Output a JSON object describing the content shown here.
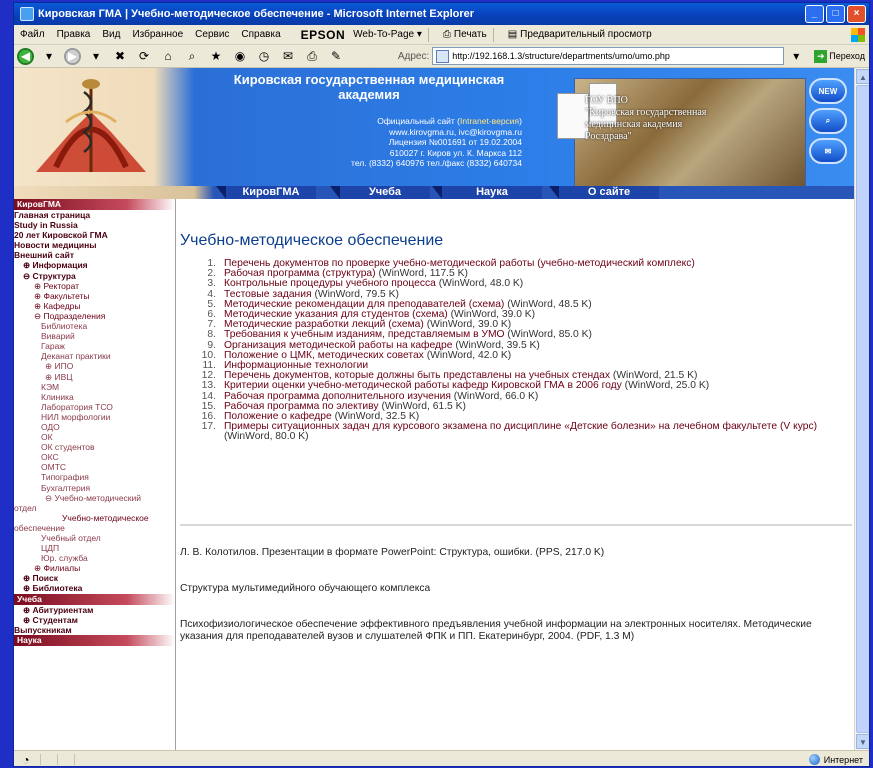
{
  "window": {
    "title": "Кировская ГМА | Учебно-методическое обеспечение - Microsoft Internet Explorer",
    "controls": [
      "_",
      "□",
      "×"
    ]
  },
  "menubar": {
    "items": [
      "Файл",
      "Правка",
      "Вид",
      "Избранное",
      "Сервис",
      "Справка"
    ],
    "epson": "EPSON",
    "web_to_page": "Web-To-Page ▾",
    "print": "Печать",
    "preview": "Предварительный просмотр"
  },
  "toolbar": {
    "address_label": "Адрес:",
    "address_value": "http://192.168.1.3/structure/departments/umo/umo.php",
    "go_label": "Переход"
  },
  "banner": {
    "title_line1": "Кировская государственная медицинская",
    "title_line2": "академия",
    "info_line1_prefix": "Официальный сайт (",
    "info_line1_kv": "Intranet-версия",
    "info_line1_suffix": ")",
    "info_line2": "www.kirovgma.ru, ivc@kirovgma.ru",
    "info_line3": "Лицензия №001691 от 19.02.2004",
    "info_line4": "610027 г. Киров ул. К. Маркса 112",
    "info_line5": "тел. (8332) 640976 тел./факс (8332) 640734",
    "plaque_line1": "ГОУ ВПО",
    "plaque_line2": "\"Кировская государственная",
    "plaque_line3": "медицинская академия",
    "plaque_line4": "Росздрава\"",
    "side_buttons": [
      "NEW",
      "⌕",
      "✉"
    ]
  },
  "nav": {
    "tabs": [
      "КировГМА",
      "Учеба",
      "Наука",
      "О сайте"
    ]
  },
  "sidebar": {
    "section_kirov": "КировГМА",
    "items": [
      {
        "label": "Главная страница",
        "cls": "b"
      },
      {
        "label": "Study in Russia",
        "cls": "b"
      },
      {
        "label": "20 лет Кировской ГМА",
        "cls": "b"
      },
      {
        "label": "Новости медицины",
        "cls": "b"
      },
      {
        "label": "Внешний сайт",
        "cls": "b"
      },
      {
        "label": "⊕ Информация",
        "cls": "b l1"
      },
      {
        "label": "⊖ Структура",
        "cls": "b l1"
      },
      {
        "label": "⊕ Ректорат",
        "cls": "l2"
      },
      {
        "label": "⊕ Факультеты",
        "cls": "l2"
      },
      {
        "label": "⊕ Кафедры",
        "cls": "l2"
      },
      {
        "label": "⊖ Подразделения",
        "cls": "l2"
      },
      {
        "label": "Библиотека",
        "cls": "l3"
      },
      {
        "label": "Виварий",
        "cls": "l3"
      },
      {
        "label": "Гараж",
        "cls": "l3"
      },
      {
        "label": "Деканат практики",
        "cls": "l3"
      },
      {
        "label": "⊕ ИПО",
        "cls": "l4"
      },
      {
        "label": "⊕ ИВЦ",
        "cls": "l4"
      },
      {
        "label": "КЭМ",
        "cls": "l3"
      },
      {
        "label": "Клиника",
        "cls": "l3"
      },
      {
        "label": "Лаборатория ТСО",
        "cls": "l3"
      },
      {
        "label": "НИЛ морфологии",
        "cls": "l3"
      },
      {
        "label": "ОДО",
        "cls": "l3"
      },
      {
        "label": "ОК",
        "cls": "l3"
      },
      {
        "label": "ОК студентов",
        "cls": "l3"
      },
      {
        "label": "ОКС",
        "cls": "l3"
      },
      {
        "label": "ОМТС",
        "cls": "l3"
      },
      {
        "label": "Типография",
        "cls": "l3"
      },
      {
        "label": "Бухгалтерия",
        "cls": "l3"
      },
      {
        "label": "⊖ Учебно-методический",
        "cls": "l4"
      },
      {
        "label": "отдел",
        "cls": "l0"
      },
      {
        "label": "Учебно-методическое",
        "cls": "wrap"
      },
      {
        "label": "обеспечение",
        "cls": "l0"
      },
      {
        "label": "Учебный отдел",
        "cls": "l3"
      },
      {
        "label": "ЦДП",
        "cls": "l3"
      },
      {
        "label": "Юр. служба",
        "cls": "l3"
      },
      {
        "label": "⊕ Филиалы",
        "cls": "l2"
      },
      {
        "label": "⊕ Поиск",
        "cls": "b l1"
      },
      {
        "label": "⊕ Библиотека",
        "cls": "b l1"
      }
    ],
    "section_study": "Учеба",
    "study_items": [
      {
        "label": "⊕ Абитуриентам",
        "cls": "b l1"
      },
      {
        "label": "⊕ Студентам",
        "cls": "b l1"
      },
      {
        "label": "Выпускникам",
        "cls": "b"
      }
    ],
    "section_science": "Наука"
  },
  "content": {
    "title": "Учебно-методическое обеспечение",
    "documents": [
      {
        "n": "1.",
        "text": "Перечень документов по проверке учебно-методической работы (учебно-методический комплекс)",
        "meta": ""
      },
      {
        "n": "2.",
        "text": "Рабочая программа (структура)",
        "meta": " (WinWord, 117.5 K)"
      },
      {
        "n": "3.",
        "text": "Контрольные процедуры учебного процесса",
        "meta": " (WinWord, 48.0 K)"
      },
      {
        "n": "4.",
        "text": "Тестовые задания",
        "meta": " (WinWord, 79.5 K)"
      },
      {
        "n": "5.",
        "text": "Методические рекомендации для преподавателей (схема)",
        "meta": " (WinWord, 48.5 K)"
      },
      {
        "n": "6.",
        "text": "Методические указания для студентов (схема)",
        "meta": " (WinWord, 39.0 K)"
      },
      {
        "n": "7.",
        "text": "Методические разработки лекций (схема)",
        "meta": " (WinWord, 39.0 K)"
      },
      {
        "n": "8.",
        "text": "Требования к учебным изданиям, представляемым в УМО",
        "meta": " (WinWord, 85.0 K)"
      },
      {
        "n": "9.",
        "text": "Организация методической работы на кафедре",
        "meta": " (WinWord, 39.5 K)"
      },
      {
        "n": "10.",
        "text": "Положение о ЦМК, методических советах",
        "meta": " (WinWord, 42.0 K)"
      },
      {
        "n": "11.",
        "text": "Информационные технологии",
        "meta": ""
      },
      {
        "n": "12.",
        "text": "Перечень документов, которые должны быть представлены на учебных стендах",
        "meta": " (WinWord, 21.5 K)"
      },
      {
        "n": "13.",
        "text": "Критерии оценки учебно-методической работы кафедр Кировской ГМА в 2006 году",
        "meta": " (WinWord, 25.0 K)"
      },
      {
        "n": "14.",
        "text": "Рабочая программа дополнительного изучения",
        "meta": " (WinWord, 66.0 K)"
      },
      {
        "n": "15.",
        "text": "Рабочая программа по элективу",
        "meta": " (WinWord, 61.5 K)"
      },
      {
        "n": "16.",
        "text": "Положение о кафедре",
        "meta": " (WinWord, 32.5 K)"
      },
      {
        "n": "17.",
        "text": "Примеры ситуационных задач для курсового экзамена по дисциплине «Детские болезни» на лечебном факультете (V курс)",
        "meta": " (WinWord, 80.0 K)"
      }
    ],
    "presentations": "Л. В. Колотилов. Презентации в формате PowerPoint: Структура, ошибки. (PPS, 217.0 K)",
    "multimedia": "Структура мультимедийного обучающего комплекса",
    "psychophys": "Психофизиологическое обеспечение эффективного предъявления учебной информации на электронных носителях. Методические указания для преподавателей вузов и слушателей ФПК и ПП. Екатеринбург, 2004. (PDF, 1.3 M)"
  },
  "statusbar": {
    "zone": "Интернет"
  }
}
